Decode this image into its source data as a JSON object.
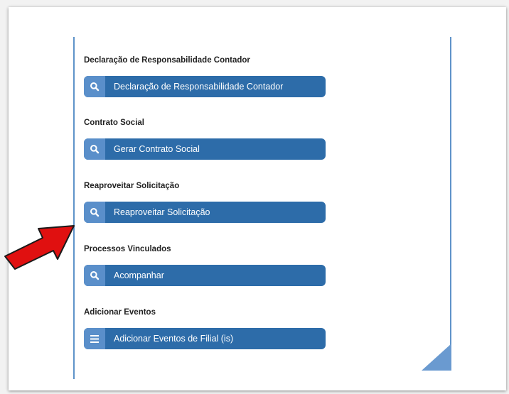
{
  "sections": [
    {
      "title": "Declaração de Responsabilidade Contador",
      "button_label": "Declaração de Responsabilidade Contador",
      "icon": "search-icon"
    },
    {
      "title": "Contrato Social",
      "button_label": "Gerar Contrato Social",
      "icon": "search-icon"
    },
    {
      "title": "Reaproveitar Solicitação",
      "button_label": "Reaproveitar Solicitação",
      "icon": "search-icon"
    },
    {
      "title": "Processos Vinculados",
      "button_label": "Acompanhar",
      "icon": "search-icon"
    },
    {
      "title": "Adicionar Eventos",
      "button_label": "Adicionar Eventos de Filial (is)",
      "icon": "menu-icon"
    }
  ],
  "annotation": {
    "arrow_color": "#e01010",
    "points_to": "Reaproveitar Solicitação"
  },
  "colors": {
    "button_bg": "#2d6ca9",
    "icon_bg": "#5a8fca",
    "border_line": "#5f93c9"
  }
}
